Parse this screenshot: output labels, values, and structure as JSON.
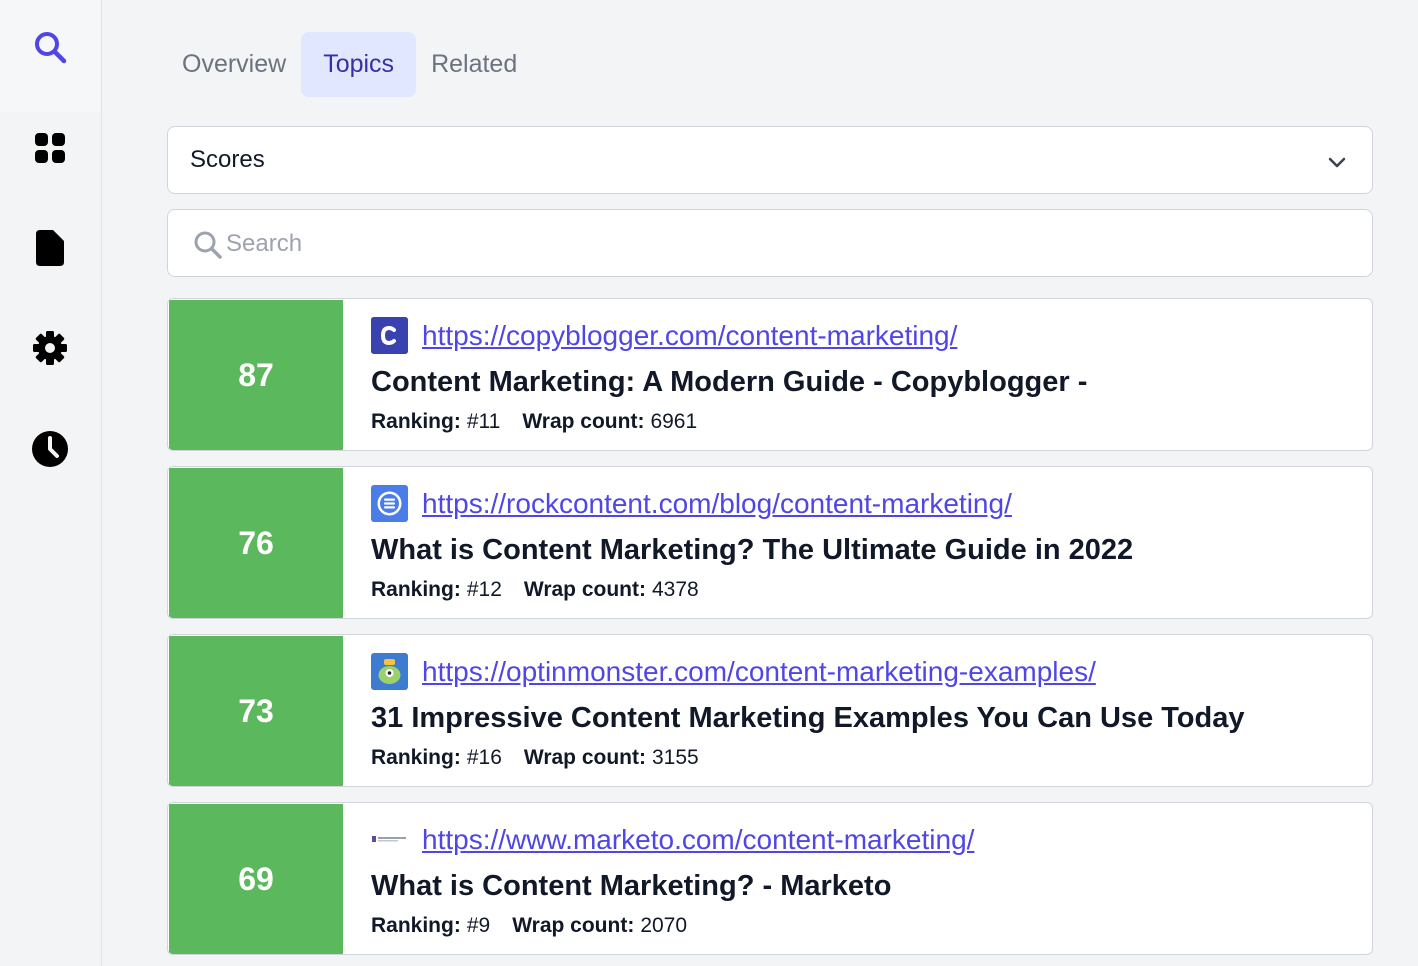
{
  "sidebar": {
    "items": [
      {
        "icon": "search-icon",
        "active": true
      },
      {
        "icon": "dashboard-grid-icon",
        "active": false
      },
      {
        "icon": "document-icon",
        "active": false
      },
      {
        "icon": "gear-icon",
        "active": false
      },
      {
        "icon": "clock-icon",
        "active": false
      }
    ],
    "active_color": "#4f46e5"
  },
  "tabs": [
    {
      "label": "Overview",
      "active": false
    },
    {
      "label": "Topics",
      "active": true
    },
    {
      "label": "Related",
      "active": false
    }
  ],
  "sort_select": {
    "value": "Scores"
  },
  "search": {
    "placeholder": "Search",
    "value": ""
  },
  "labels": {
    "ranking": "Ranking:",
    "wrap_count": "Wrap count:"
  },
  "colors": {
    "score_green": "#5cb85c",
    "link": "#4f46e5",
    "active_tab_bg": "#e0e7ff"
  },
  "results": [
    {
      "score": "87",
      "favicon": "copyblogger-c-icon",
      "url": "https://copyblogger.com/content-marketing/",
      "title": "Content Marketing: A Modern Guide - Copyblogger -",
      "ranking": "#11",
      "wrap_count": "6961"
    },
    {
      "score": "76",
      "favicon": "rockcontent-icon",
      "url": "https://rockcontent.com/blog/content-marketing/",
      "title": "What is Content Marketing? The Ultimate Guide in 2022",
      "ranking": "#12",
      "wrap_count": "4378"
    },
    {
      "score": "73",
      "favicon": "optinmonster-icon",
      "url": "https://optinmonster.com/content-marketing-examples/",
      "title": "31 Impressive Content Marketing Examples You Can Use Today",
      "ranking": "#16",
      "wrap_count": "3155"
    },
    {
      "score": "69",
      "favicon": "marketo-icon",
      "url": "https://www.marketo.com/content-marketing/",
      "title": "What is Content Marketing? - Marketo",
      "ranking": "#9",
      "wrap_count": "2070"
    }
  ]
}
